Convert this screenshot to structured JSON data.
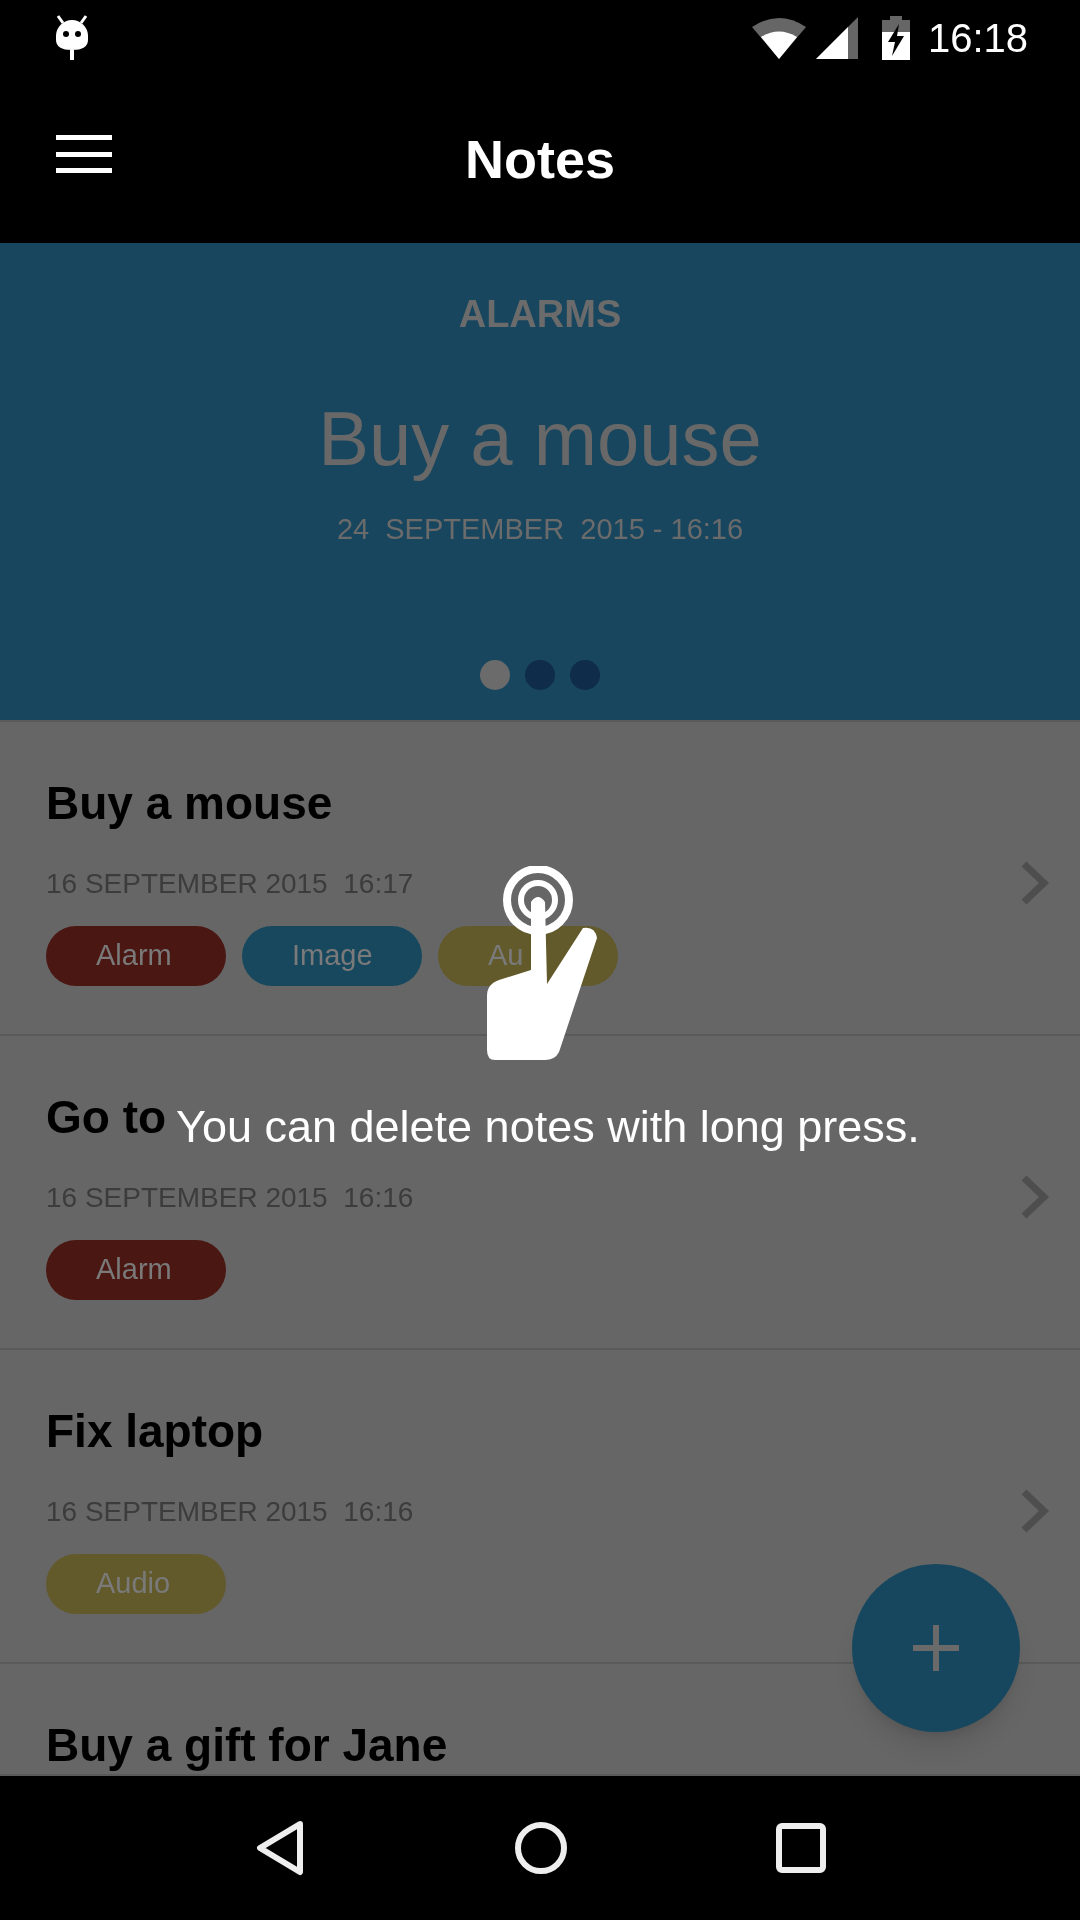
{
  "status_bar": {
    "time": "16:18"
  },
  "app_bar": {
    "title": "Notes"
  },
  "alarm_banner": {
    "heading": "ALARMS",
    "title": "Buy a mouse",
    "datetime": "24  SEPTEMBER  2015 - 16:16",
    "pages": [
      {
        "selected": true
      },
      {
        "selected": false
      },
      {
        "selected": false
      }
    ]
  },
  "notes": [
    {
      "title": "Buy a mouse",
      "date": "16 SEPTEMBER 2015  16:17",
      "tags": [
        {
          "label": "Alarm",
          "color": "#4a1712"
        },
        {
          "label": "Image",
          "color": "#17485e"
        },
        {
          "label": "Au",
          "color": "#635a2c"
        }
      ]
    },
    {
      "title": "Go to",
      "date": "16 SEPTEMBER 2015  16:16",
      "tags": [
        {
          "label": "Alarm",
          "color": "#4a1712"
        }
      ]
    },
    {
      "title": "Fix laptop",
      "date": "16 SEPTEMBER 2015  16:16",
      "tags": [
        {
          "label": "Audio",
          "color": "#635a2c"
        }
      ]
    },
    {
      "title": "Buy a gift for Jane"
    }
  ],
  "tutorial_hint": {
    "text": "You can delete notes with long press."
  }
}
